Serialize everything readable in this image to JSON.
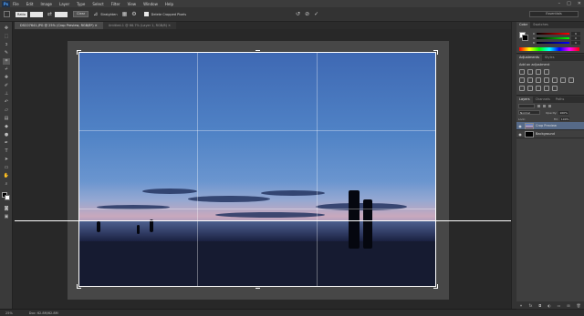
{
  "app": {
    "logo": "Ps"
  },
  "menu": [
    "File",
    "Edit",
    "Image",
    "Layer",
    "Type",
    "Select",
    "Filter",
    "View",
    "Window",
    "Help"
  ],
  "window_controls": [
    "–",
    "□",
    "✕"
  ],
  "options": {
    "ratio_select": "Ratio",
    "clear_button": "Clear",
    "straighten_label": "Straighten",
    "delete_pixels_label": "Delete Cropped Pixels",
    "workspace": "Essentials",
    "icons": [
      "crop-tool-icon",
      "swap-icon",
      "grid-overlay-icon",
      "settings-gear-icon",
      "reset-icon",
      "cancel-icon",
      "commit-icon"
    ]
  },
  "document_tabs": [
    {
      "label": "DSC07641.JPG @ 25% (Crop Preview, RGB/8*) ✕",
      "active": true
    },
    {
      "label": "Untitled-1 @ 66.7% (Layer 1, RGB/8) ✕",
      "active": false
    }
  ],
  "status": {
    "zoom": "25%",
    "doc_size": "Doc: 62.8M/62.8M"
  },
  "panels": {
    "color_tabs": [
      "Color",
      "Swatches"
    ],
    "color_channels": [
      {
        "label": "R",
        "value": "0",
        "gradient": "linear-gradient(90deg,#000,#f00)"
      },
      {
        "label": "G",
        "value": "0",
        "gradient": "linear-gradient(90deg,#000,#0f0)"
      },
      {
        "label": "B",
        "value": "0",
        "gradient": "linear-gradient(90deg,#000,#00f)"
      }
    ],
    "adjust_tabs": [
      "Adjustments",
      "Styles"
    ],
    "adjust_title": "Add an adjustment",
    "layers_tabs": [
      "Layers",
      "Channels",
      "Paths"
    ],
    "blend_mode": "Normal",
    "opacity_label": "Opacity:",
    "opacity": "100%",
    "lock_label": "Lock:",
    "fill_label": "Fill:",
    "fill": "100%",
    "layers": [
      {
        "name": "Crop Preview",
        "selected": true
      },
      {
        "name": "Background",
        "selected": false
      }
    ]
  }
}
